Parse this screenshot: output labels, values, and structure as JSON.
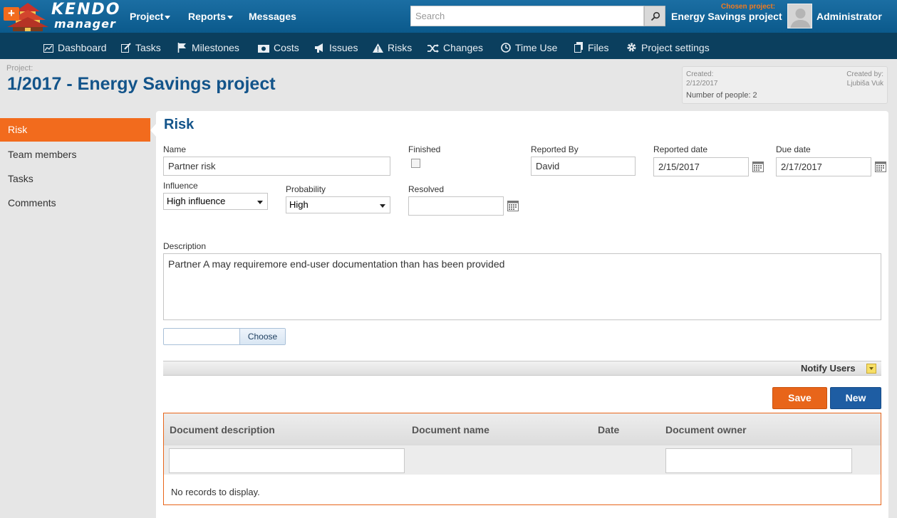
{
  "topbar": {
    "logo_line1": "KENDO",
    "logo_line2": "manager",
    "nav": [
      {
        "label": "Project"
      },
      {
        "label": "Reports"
      },
      {
        "label": "Messages"
      }
    ],
    "search_placeholder": "Search",
    "chosen_label": "Chosen project:",
    "chosen_project": "Energy Savings project",
    "user": "Administrator"
  },
  "subnav": [
    {
      "label": "Dashboard",
      "icon": "dashboard-icon"
    },
    {
      "label": "Tasks",
      "icon": "edit-icon"
    },
    {
      "label": "Milestones",
      "icon": "flag-icon"
    },
    {
      "label": "Costs",
      "icon": "money-icon"
    },
    {
      "label": "Issues",
      "icon": "megaphone-icon"
    },
    {
      "label": "Risks",
      "icon": "warning-icon"
    },
    {
      "label": "Changes",
      "icon": "shuffle-icon"
    },
    {
      "label": "Time Use",
      "icon": "clock-icon"
    },
    {
      "label": "Files",
      "icon": "files-icon"
    },
    {
      "label": "Project settings",
      "icon": "gear-icon"
    }
  ],
  "project": {
    "label": "Project:",
    "title": "1/2017 - Energy Savings project",
    "created_label": "Created:",
    "created_value": "2/12/2017",
    "created_by_label": "Created by:",
    "created_by_value": "Ljubiša Vuk",
    "people": "Number of people: 2"
  },
  "sidebar": [
    {
      "label": "Risk",
      "active": true
    },
    {
      "label": "Team members"
    },
    {
      "label": "Tasks"
    },
    {
      "label": "Comments"
    }
  ],
  "form": {
    "title": "Risk",
    "name_label": "Name",
    "name_value": "Partner risk",
    "finished_label": "Finished",
    "finished_checked": false,
    "reported_by_label": "Reported By",
    "reported_by_value": "David",
    "reported_date_label": "Reported date",
    "reported_date_value": "2/15/2017",
    "due_date_label": "Due date",
    "due_date_value": "2/17/2017",
    "influence_label": "Influence",
    "influence_value": "High influence",
    "probability_label": "Probability",
    "probability_value": "High",
    "resolved_label": "Resolved",
    "resolved_value": "",
    "description_label": "Description",
    "description_value": "Partner A may requiremore end-user documentation than has been provided",
    "choose_label": "Choose",
    "notify_label": "Notify Users",
    "save_label": "Save",
    "new_label": "New"
  },
  "grid": {
    "columns": [
      "Document description",
      "Document name",
      "Date",
      "Document owner"
    ],
    "empty_text": "No records to display."
  },
  "colors": {
    "accent": "#f26b1d",
    "brand": "#13548a",
    "nav_dark": "#0b3f5e"
  }
}
